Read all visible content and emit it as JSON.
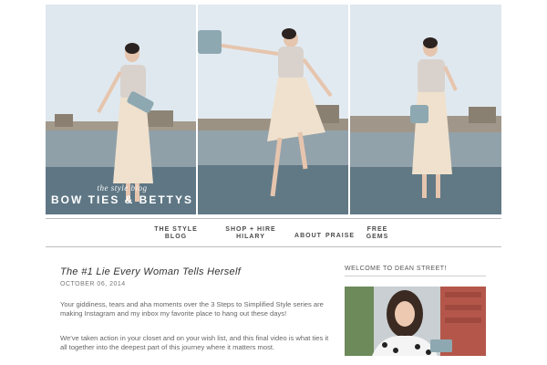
{
  "header": {
    "logo_top": "the style blog",
    "logo_main": "BOW TIES & BETTYS"
  },
  "nav": {
    "items": [
      {
        "label": "THE STYLE\nBLOG"
      },
      {
        "label": "SHOP + HIRE\nHILARY"
      },
      {
        "label": "ABOUT"
      },
      {
        "label": "PRAISE"
      },
      {
        "label": "FREE\nGEMS"
      }
    ]
  },
  "post": {
    "title": "The #1 Lie Every Woman Tells Herself",
    "date": "OCTOBER 06, 2014",
    "paragraphs": [
      "Your giddiness, tears and aha moments over the 3 Steps to Simplified Style series are making Instagram and my inbox my favorite place to hang out these days!",
      "We've taken action in your closet and on your wish list, and this final video is what ties it all together into the deepest part of this journey where it matters most."
    ]
  },
  "sidebar": {
    "title": "WELCOME TO DEAN STREET!"
  },
  "colors": {
    "sky": "#dde6ee",
    "rooftop": "#6f8896",
    "nav_text": "#4a4a4a",
    "rule": "#bdbdbd"
  }
}
